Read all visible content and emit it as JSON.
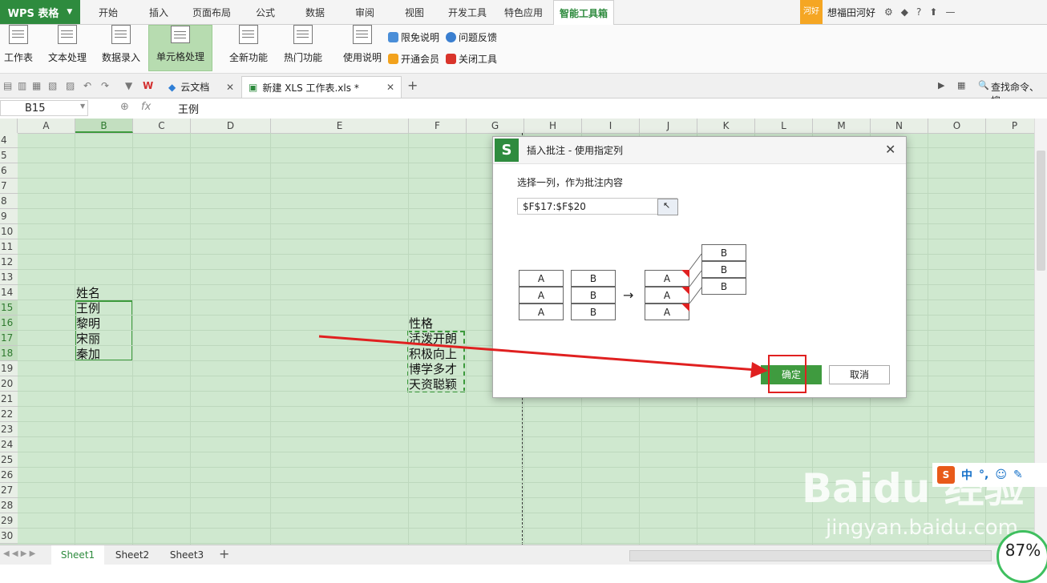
{
  "app": {
    "name": "WPS 表格"
  },
  "menu_tabs": [
    "开始",
    "插入",
    "页面布局",
    "公式",
    "数据",
    "审阅",
    "视图",
    "开发工具",
    "特色应用",
    "智能工具箱"
  ],
  "active_menu": "智能工具箱",
  "user": {
    "badge": "河好",
    "name": "想福田河好"
  },
  "ribbon": {
    "buttons": [
      "工作表",
      "文本处理",
      "数据录入",
      "单元格处理",
      "全新功能",
      "热门功能",
      "使用说明"
    ],
    "small": [
      "限免说明",
      "问题反馈",
      "开通会员",
      "关闭工具"
    ]
  },
  "doc_tabs": [
    "云文档",
    "新建 XLS 工作表.xls *"
  ],
  "search_placeholder": "查找命令、搜",
  "formula": {
    "cell_ref": "B15",
    "fx": "fx",
    "value": "王例"
  },
  "columns": [
    "A",
    "B",
    "C",
    "D",
    "E",
    "F",
    "G",
    "H",
    "I",
    "J",
    "K",
    "L",
    "M",
    "N",
    "O",
    "P"
  ],
  "rows": [
    "4",
    "5",
    "6",
    "7",
    "8",
    "9",
    "10",
    "11",
    "12",
    "13",
    "14",
    "15",
    "16",
    "17",
    "18",
    "19",
    "20",
    "21",
    "22",
    "23",
    "24",
    "25",
    "26",
    "27",
    "28",
    "29",
    "30"
  ],
  "cells": {
    "b_header": "姓名",
    "b_values": [
      "王例",
      "黎明",
      "宋丽",
      "秦加"
    ],
    "f_header": "性格",
    "f_values": [
      "活泼开朗",
      "积极向上",
      "博学多才",
      "天资聪颖"
    ]
  },
  "sheets": [
    "Sheet1",
    "Sheet2",
    "Sheet3"
  ],
  "dialog": {
    "title": "插入批注 - 使用指定列",
    "prompt": "选择一列，作为批注内容",
    "range": "$F$17:$F$20",
    "diagram_a": [
      "A",
      "A",
      "A"
    ],
    "diagram_b": [
      "B",
      "B",
      "B"
    ],
    "ok": "确定",
    "cancel": "取消",
    "close": "✕"
  },
  "ime": {
    "lang": "中",
    "punct": "°,"
  },
  "watermark": {
    "text": "Baidu 经验",
    "url": "jingyan.baidu.com"
  },
  "zoom": {
    "value": "87%"
  },
  "colors": {
    "accent": "#2e8b3e",
    "grid_bg": "#cfe8cf",
    "arrow": "#e02020"
  }
}
